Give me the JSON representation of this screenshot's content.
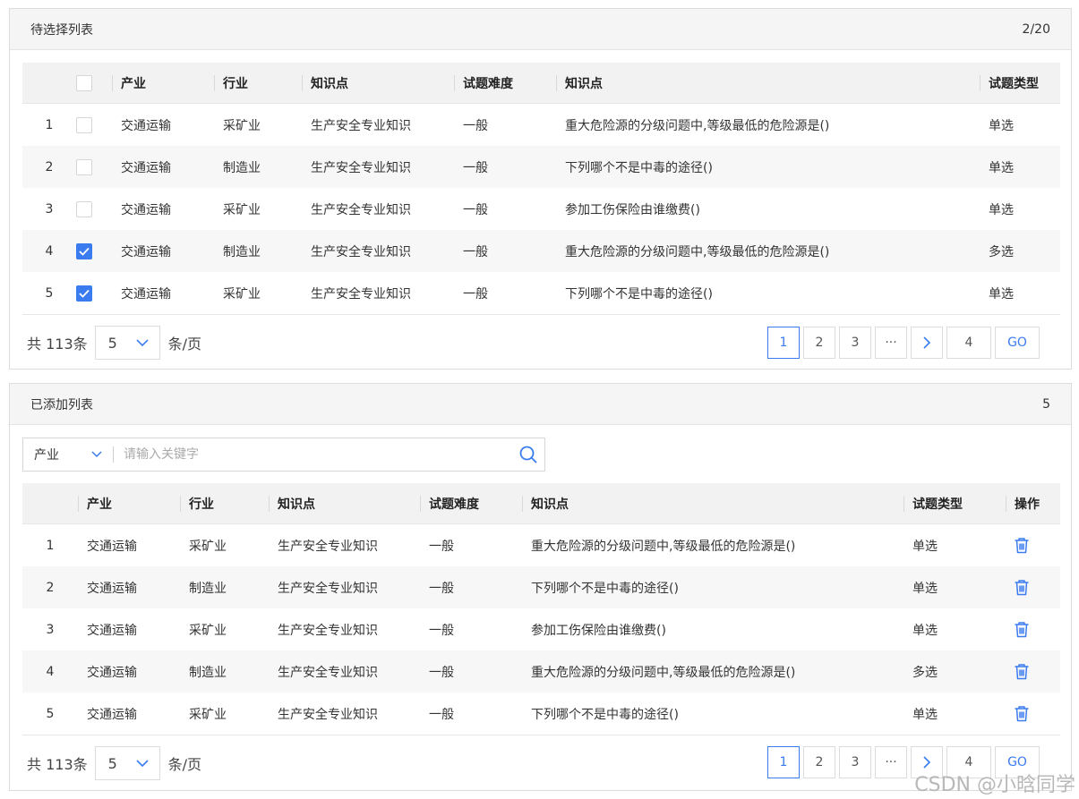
{
  "top_panel": {
    "title": "待选择列表",
    "counter": "2/20",
    "columns": [
      "产业",
      "行业",
      "知识点",
      "试题难度",
      "知识点",
      "试题类型"
    ],
    "rows": [
      {
        "index": "1",
        "checked": false,
        "industry": "交通运输",
        "trade": "采矿业",
        "knowledge": "生产安全专业知识",
        "difficulty": "一般",
        "question": "重大危险源的分级问题中,等级最低的危险源是()",
        "type": "单选"
      },
      {
        "index": "2",
        "checked": false,
        "industry": "交通运输",
        "trade": "制造业",
        "knowledge": "生产安全专业知识",
        "difficulty": "一般",
        "question": "下列哪个不是中毒的途径()",
        "type": "单选"
      },
      {
        "index": "3",
        "checked": false,
        "industry": "交通运输",
        "trade": "采矿业",
        "knowledge": "生产安全专业知识",
        "difficulty": "一般",
        "question": "参加工伤保险由谁缴费()",
        "type": "单选"
      },
      {
        "index": "4",
        "checked": true,
        "industry": "交通运输",
        "trade": "制造业",
        "knowledge": "生产安全专业知识",
        "difficulty": "一般",
        "question": "重大危险源的分级问题中,等级最低的危险源是()",
        "type": "多选"
      },
      {
        "index": "5",
        "checked": true,
        "industry": "交通运输",
        "trade": "采矿业",
        "knowledge": "生产安全专业知识",
        "difficulty": "一般",
        "question": "下列哪个不是中毒的途径()",
        "type": "单选"
      }
    ],
    "pagination": {
      "total_label": "共 113条",
      "page_size": "5",
      "per_page_label": "条/页",
      "pages": [
        "1",
        "2",
        "3"
      ],
      "ellipsis": "···",
      "jump_value": "4",
      "go_label": "GO"
    }
  },
  "bottom_panel": {
    "title": "已添加列表",
    "counter": "5",
    "search": {
      "select_value": "产业",
      "placeholder": "请输入关键字"
    },
    "columns": [
      "产业",
      "行业",
      "知识点",
      "试题难度",
      "知识点",
      "试题类型",
      "操作"
    ],
    "rows": [
      {
        "index": "1",
        "industry": "交通运输",
        "trade": "采矿业",
        "knowledge": "生产安全专业知识",
        "difficulty": "一般",
        "question": "重大危险源的分级问题中,等级最低的危险源是()",
        "type": "单选",
        "action_icon": "trash-icon"
      },
      {
        "index": "2",
        "industry": "交通运输",
        "trade": "制造业",
        "knowledge": "生产安全专业知识",
        "difficulty": "一般",
        "question": "下列哪个不是中毒的途径()",
        "type": "单选",
        "action_icon": "trash-icon"
      },
      {
        "index": "3",
        "industry": "交通运输",
        "trade": "采矿业",
        "knowledge": "生产安全专业知识",
        "difficulty": "一般",
        "question": "参加工伤保险由谁缴费()",
        "type": "单选",
        "action_icon": "trash-icon"
      },
      {
        "index": "4",
        "industry": "交通运输",
        "trade": "制造业",
        "knowledge": "生产安全专业知识",
        "difficulty": "一般",
        "question": "重大危险源的分级问题中,等级最低的危险源是()",
        "type": "多选",
        "action_icon": "trash-icon"
      },
      {
        "index": "5",
        "industry": "交通运输",
        "trade": "采矿业",
        "knowledge": "生产安全专业知识",
        "difficulty": "一般",
        "question": "下列哪个不是中毒的途径()",
        "type": "单选",
        "action_icon": "trash-icon"
      }
    ],
    "pagination": {
      "total_label": "共 113条",
      "page_size": "5",
      "per_page_label": "条/页",
      "pages": [
        "1",
        "2",
        "3"
      ],
      "ellipsis": "···",
      "jump_value": "4",
      "go_label": "GO"
    }
  },
  "colors": {
    "accent": "#3a7bf0",
    "header_bg": "#f5f5f5",
    "stripe_bg": "#f7f7f7",
    "border": "#dcdcdc"
  },
  "watermark": "CSDN @小晗同学"
}
